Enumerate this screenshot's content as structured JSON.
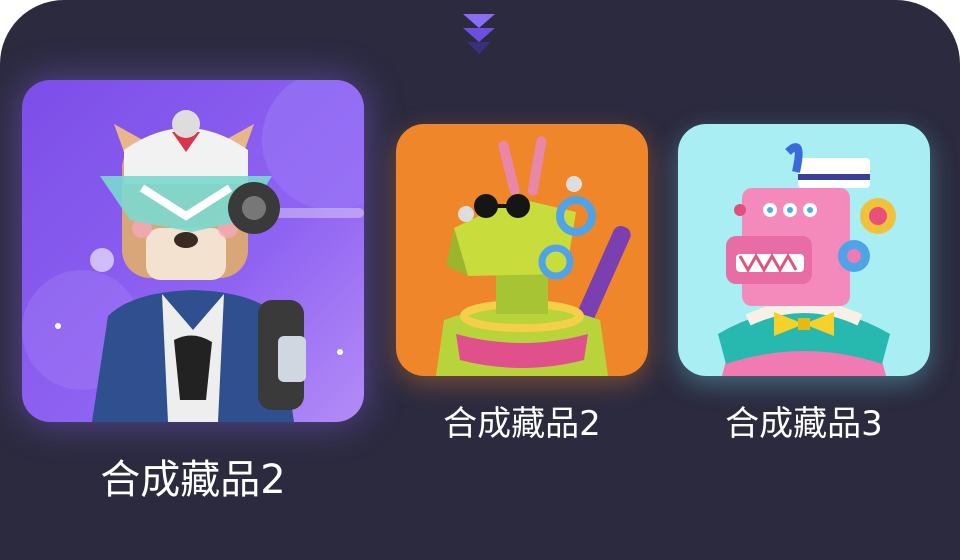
{
  "icons": {
    "expand": "double-chevron-down-icon"
  },
  "colors": {
    "panel_background": "#2b2a3f",
    "chevron": "#7b5cf0",
    "card_1_background": "#8a5ef0",
    "card_2_background": "#f0862a",
    "card_3_background": "#a8eef3"
  },
  "collectibles": [
    {
      "name": "合成藏品2"
    },
    {
      "name": "合成藏品2"
    },
    {
      "name": "合成藏品3"
    }
  ]
}
